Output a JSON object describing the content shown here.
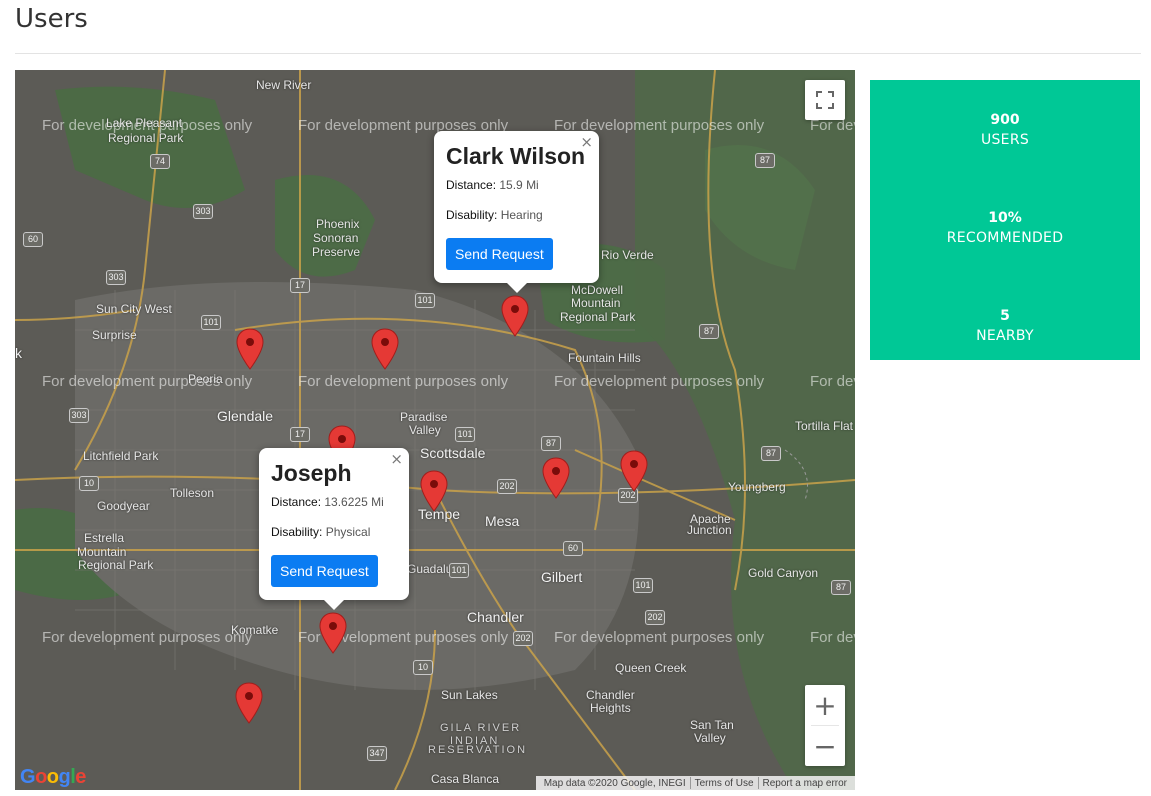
{
  "page": {
    "title": "Users"
  },
  "map": {
    "watermark": "For development purposes only",
    "labels": {
      "new_river": "New River",
      "lake_pleasant": "Lake Pleasant",
      "regional_park": "Regional Park",
      "phoenix": "Phoenix",
      "sonoran": "Sonoran",
      "preserve": "Preserve",
      "sun_city_west": "Sun City West",
      "surprise": "Surprise",
      "glendale": "Glendale",
      "peoria": "Peoria",
      "paradise": "Paradise",
      "valley": "Valley",
      "scottsdale": "Scottsdale",
      "litchfield_park": "Litchfield Park",
      "tolleson": "Tolleson",
      "goodyear": "Goodyear",
      "estrella": "Estrella",
      "mountain": "Mountain",
      "estrella_regional_park": "Regional Park",
      "tempe": "Tempe",
      "mesa": "Mesa",
      "gilbert": "Gilbert",
      "chandler": "Chandler",
      "komatke": "Komatke",
      "guadalupe": "Guadalupe",
      "sun_lakes": "Sun Lakes",
      "gila_river": "GILA RIVER",
      "indian": "INDIAN",
      "reservation": "RESERVATION",
      "casa_blanca": "Casa Blanca",
      "chandler_heights": "Chandler",
      "heights": "Heights",
      "queen_creek": "Queen Creek",
      "san_tan": "San Tan",
      "valley2": "Valley",
      "gold_canyon": "Gold Canyon",
      "apache": "Apache",
      "junction": "Junction",
      "youngberg": "Youngberg",
      "tortilla_flat": "Tortilla Flat",
      "fountain_hills": "Fountain Hills",
      "mcdowell": "McDowell",
      "mountain2": "Mountain",
      "regional_park2": "Regional Park",
      "rio_verde": "Rio Verde",
      "k": "k"
    },
    "shields": [
      "74",
      "303",
      "60",
      "303",
      "17",
      "101",
      "101",
      "17",
      "303",
      "101",
      "87",
      "87",
      "87",
      "10",
      "202",
      "101",
      "60",
      "202",
      "101",
      "202",
      "10",
      "202",
      "87",
      "347",
      "87",
      "60"
    ],
    "controls": {
      "fullscreen_icon": "fullscreen-icon",
      "zoom_in": "+",
      "zoom_out": "−"
    },
    "logo_text": "Google",
    "attribution": {
      "map_data": "Map data ©2020 Google, INEGI",
      "terms": "Terms of Use",
      "report": "Report a map error"
    },
    "infowindows": [
      {
        "name": "Clark Wilson",
        "distance_label": "Distance:",
        "distance_value": "15.9 Mi",
        "disability_label": "Disability:",
        "disability_value": "Hearing",
        "button": "Send Request",
        "close": "×"
      },
      {
        "name": "Joseph",
        "distance_label": "Distance:",
        "distance_value": "13.6225 Mi",
        "disability_label": "Disability:",
        "disability_value": "Physical",
        "button": "Send Request",
        "close": "×"
      }
    ],
    "pin_color": "#e53935"
  },
  "stats": [
    {
      "value": "900",
      "label": "USERS"
    },
    {
      "value": "10%",
      "label": "RECOMMENDED"
    },
    {
      "value": "5",
      "label": "NEARBY"
    }
  ],
  "colors": {
    "stats_bg": "#00c896",
    "button": "#0b7cf2"
  }
}
